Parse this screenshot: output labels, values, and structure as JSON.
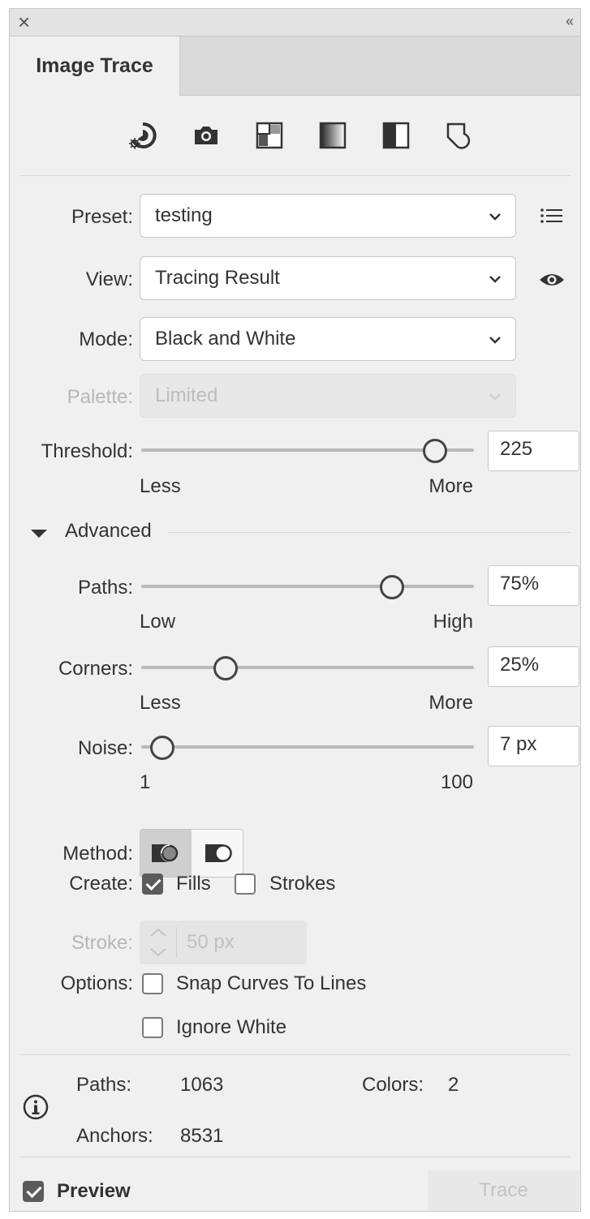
{
  "window": {
    "close_glyph": "×",
    "collapse_glyph": "‹‹"
  },
  "tab": {
    "label": "Image Trace"
  },
  "preset_icons": [
    "auto-color-icon",
    "high-color-icon",
    "low-color-icon",
    "grayscale-icon",
    "black-and-white-icon",
    "outline-icon"
  ],
  "preset": {
    "label": "Preset:",
    "value": "testing"
  },
  "view": {
    "label": "View:",
    "value": "Tracing Result"
  },
  "mode": {
    "label": "Mode:",
    "value": "Black and White"
  },
  "palette": {
    "label": "Palette:",
    "value": "Limited"
  },
  "threshold": {
    "label": "Threshold:",
    "value": "225",
    "level": 0.88,
    "min_label": "Less",
    "max_label": "More"
  },
  "advanced": {
    "label": "Advanced"
  },
  "paths": {
    "label": "Paths:",
    "value": "75%",
    "level": 0.75,
    "min_label": "Low",
    "max_label": "High"
  },
  "corners": {
    "label": "Corners:",
    "value": "25%",
    "level": 0.25,
    "min_label": "Less",
    "max_label": "More"
  },
  "noise": {
    "label": "Noise:",
    "value": "7 px",
    "level": 0.06,
    "min_label": "1",
    "max_label": "100"
  },
  "method": {
    "label": "Method:",
    "selected": "abutting"
  },
  "create": {
    "label": "Create:",
    "fills_label": "Fills",
    "fills_checked": true,
    "strokes_label": "Strokes",
    "strokes_checked": false
  },
  "stroke": {
    "label": "Stroke:",
    "value": "50 px"
  },
  "options": {
    "label": "Options:",
    "snap_label": "Snap Curves To Lines",
    "snap_checked": false,
    "ignore_white_label": "Ignore White",
    "ignore_white_checked": false
  },
  "info": {
    "paths_label": "Paths:",
    "paths_value": "1063",
    "colors_label": "Colors:",
    "colors_value": "2",
    "anchors_label": "Anchors:",
    "anchors_value": "8531"
  },
  "footer": {
    "preview_label": "Preview",
    "preview_checked": true,
    "trace_label": "Trace"
  },
  "colors": {
    "panel_bg": "#f0f0f0",
    "disabled_text": "#b7b7b7",
    "checkbox_on": "#5b5b5b"
  }
}
